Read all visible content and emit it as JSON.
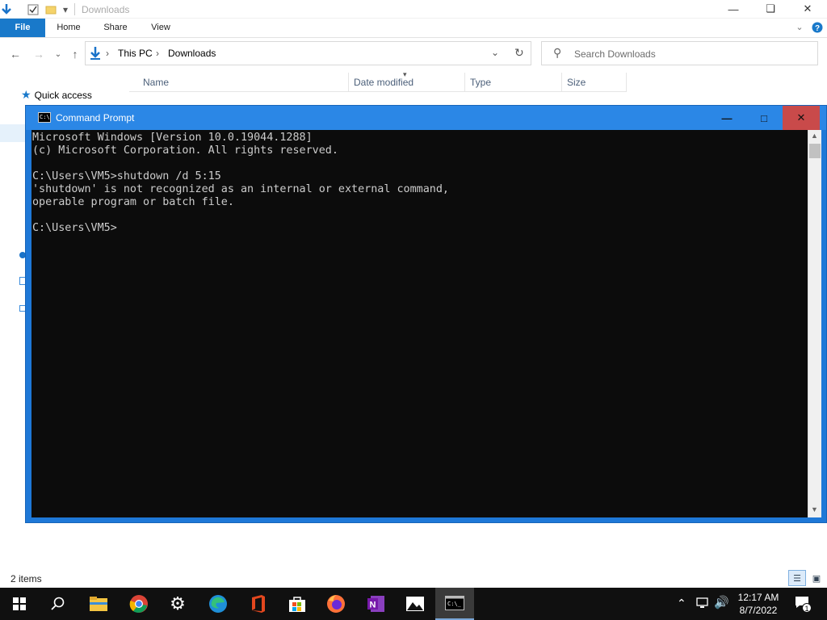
{
  "explorer": {
    "title": "Downloads",
    "ribbon_tabs": [
      "File",
      "Home",
      "Share",
      "View"
    ],
    "address": {
      "crumbs": [
        "This PC",
        "Downloads"
      ]
    },
    "search_placeholder": "Search Downloads",
    "columns": [
      "Name",
      "Date modified",
      "Type",
      "Size"
    ],
    "nav": {
      "quick_access": "Quick access"
    },
    "status": {
      "items": "2 items"
    }
  },
  "cmd": {
    "title": "Command Prompt",
    "lines": [
      "Microsoft Windows [Version 10.0.19044.1288]",
      "(c) Microsoft Corporation. All rights reserved.",
      "",
      "C:\\Users\\VM5>shutdown /d 5:15",
      "'shutdown' is not recognized as an internal or external command,",
      "operable program or batch file.",
      "",
      "C:\\Users\\VM5>"
    ]
  },
  "taskbar": {
    "apps": [
      "start-icon",
      "search-icon",
      "file-explorer-icon",
      "chrome-icon",
      "settings-icon",
      "edge-icon",
      "office-icon",
      "store-icon",
      "firefox-icon",
      "onenote-icon",
      "photos-icon",
      "cmd-icon"
    ],
    "clock": {
      "time": "12:17 AM",
      "date": "8/7/2022"
    },
    "notification_count": "1"
  },
  "colors": {
    "accent": "#1979ca",
    "cmd_title": "#2b87e6",
    "console_bg": "#0c0c0c",
    "taskbar": "#101010"
  }
}
